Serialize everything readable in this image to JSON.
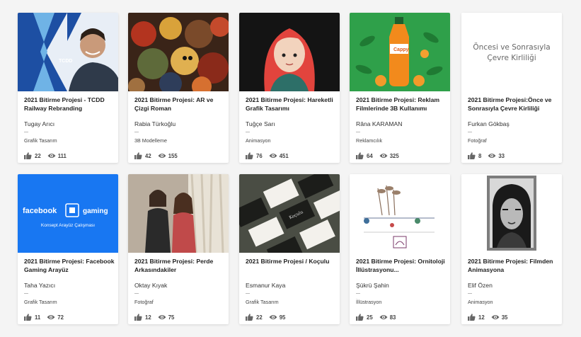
{
  "cards": [
    {
      "title": "2021 Bitirme Projesi - TCDD Railway Rebranding",
      "author": "Tugay Arıcı",
      "category": "Grafik Tasarım",
      "likes": "22",
      "views": "111",
      "thumb": "tcdd",
      "thumb_text": "TCDD"
    },
    {
      "title": "2021 Bitirme Projesi: AR ve Çizgi Roman",
      "author": "Rabia Türkoğlu",
      "category": "3B Modelleme",
      "likes": "42",
      "views": "155",
      "thumb": "ar"
    },
    {
      "title": "2021 Bitirme Projesi: Hareketli Grafik Tasarımı",
      "author": "Tuğçe Sarı",
      "category": "Animasyon",
      "likes": "76",
      "views": "451",
      "thumb": "girl"
    },
    {
      "title": "2021 Bitirme Projesi: Reklam Filmlerinde 3B Kullanımı",
      "author": "Râna KARAMAN",
      "category": "Reklamcılık",
      "likes": "64",
      "views": "325",
      "thumb": "cappy",
      "thumb_text": "Cappy"
    },
    {
      "title": "2021 Bitirme Projesi:Önce ve Sonrasıyla Çevre Kirliliği",
      "author": "Furkan Gökbaş",
      "category": "Fotoğraf",
      "likes": "8",
      "views": "33",
      "thumb": "once",
      "thumb_text_1": "Öncesi ve Sonrasıyla",
      "thumb_text_2": "Çevre Kirliliği"
    },
    {
      "title": "2021 Bitirme Projesi: Facebook Gaming Arayüz",
      "author": "Taha Yazıcı",
      "category": "Grafik Tasarım",
      "likes": "11",
      "views": "72",
      "thumb": "fb",
      "thumb_text_1": "facebook",
      "thumb_text_2": "gaming",
      "thumb_text_3": "Konsept Arayüz Çalışması"
    },
    {
      "title": "2021 Bitirme Projesi: Perde Arkasındakiler",
      "author": "Oktay Kıyak",
      "category": "Fotoğraf",
      "likes": "12",
      "views": "75",
      "thumb": "perde"
    },
    {
      "title": "2021 Bitirme Projesi / Koçulu",
      "author": "Esmanur Kaya",
      "category": "Grafik Tasarım",
      "likes": "22",
      "views": "95",
      "thumb": "koculu",
      "thumb_text": "Koçulu"
    },
    {
      "title": "2021 Bitirme Projesi: Ornitoloji İllüstrasyonu...",
      "author": "Şükrü Şahin",
      "category": "İllüstrasyon",
      "likes": "25",
      "views": "83",
      "thumb": "birds"
    },
    {
      "title": "2021 Bitirme Projesi: Filmden Animasyona",
      "author": "Elif Özen",
      "category": "Animasyon",
      "likes": "12",
      "views": "35",
      "thumb": "elif"
    }
  ],
  "colors": {
    "text": "#222222",
    "muted": "#444444",
    "icon": "#666666",
    "background": "#f4f4f4",
    "card": "#ffffff"
  },
  "icons": {
    "likes": "thumbs-up-icon",
    "views": "eye-icon"
  }
}
